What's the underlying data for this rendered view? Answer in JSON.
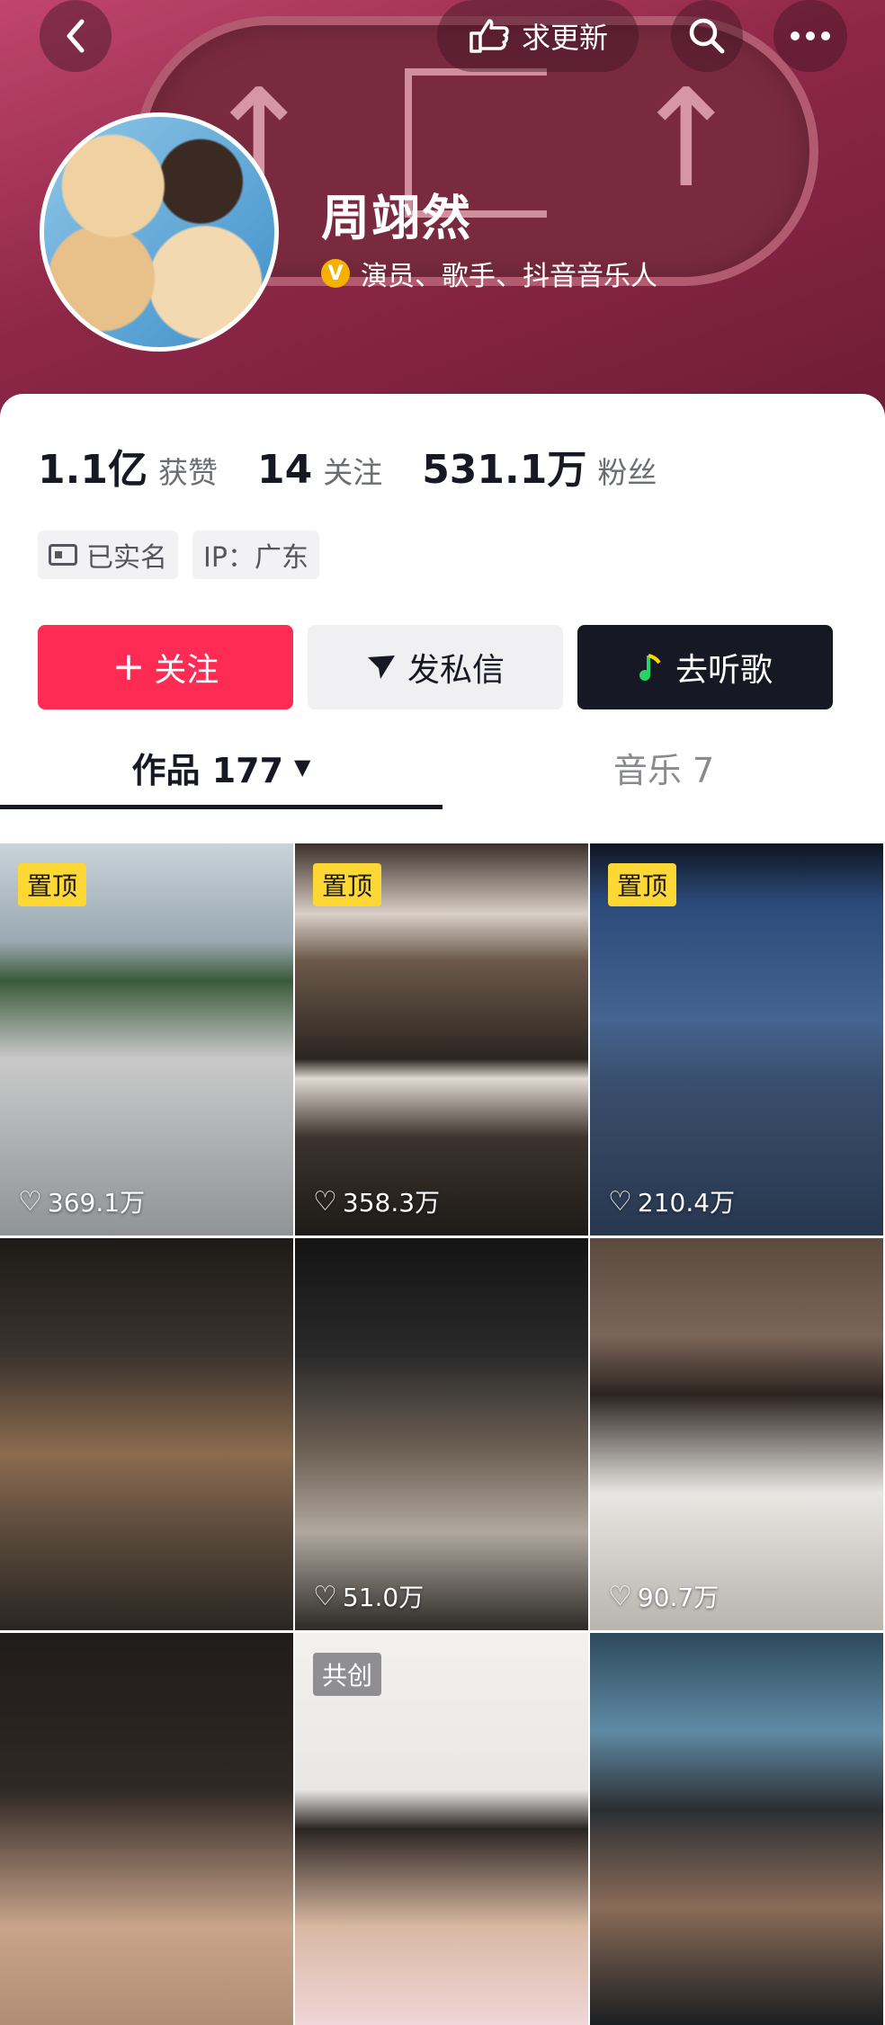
{
  "header": {
    "back_icon": "chevron-left-icon",
    "request_update_label": "求更新",
    "search_icon": "search-icon",
    "more_icon": "more-dots-icon"
  },
  "profile": {
    "name": "周翊然",
    "verified_badge": "V",
    "verified_text": "演员、歌手、抖音音乐人"
  },
  "stats": [
    {
      "num": "1.1亿",
      "label": "获赞"
    },
    {
      "num": "14",
      "label": "关注"
    },
    {
      "num": "531.1万",
      "label": "粉丝"
    }
  ],
  "tags": {
    "verified_name": "已实名",
    "ip": "IP：广东"
  },
  "buttons": {
    "follow": "关注",
    "follow_prefix": "+",
    "message": "发私信",
    "music": "去听歌"
  },
  "tabs": {
    "works": "作品 177",
    "music": "音乐 7"
  },
  "videos": [
    {
      "badge": "置顶",
      "likes": "369.1万"
    },
    {
      "badge": "置顶",
      "likes": "358.3万"
    },
    {
      "badge": "置顶",
      "likes": "210.4万"
    },
    {
      "badge": "",
      "likes": ""
    },
    {
      "badge": "",
      "likes": "51.0万"
    },
    {
      "badge": "",
      "likes": "90.7万"
    },
    {
      "badge": "",
      "likes": ""
    },
    {
      "badge": "共创",
      "likes": ""
    },
    {
      "badge": "",
      "likes": ""
    }
  ],
  "colors": {
    "accent": "#fe2c55",
    "pin": "#fdd835",
    "dark": "#161823",
    "header": "#8e2747"
  }
}
